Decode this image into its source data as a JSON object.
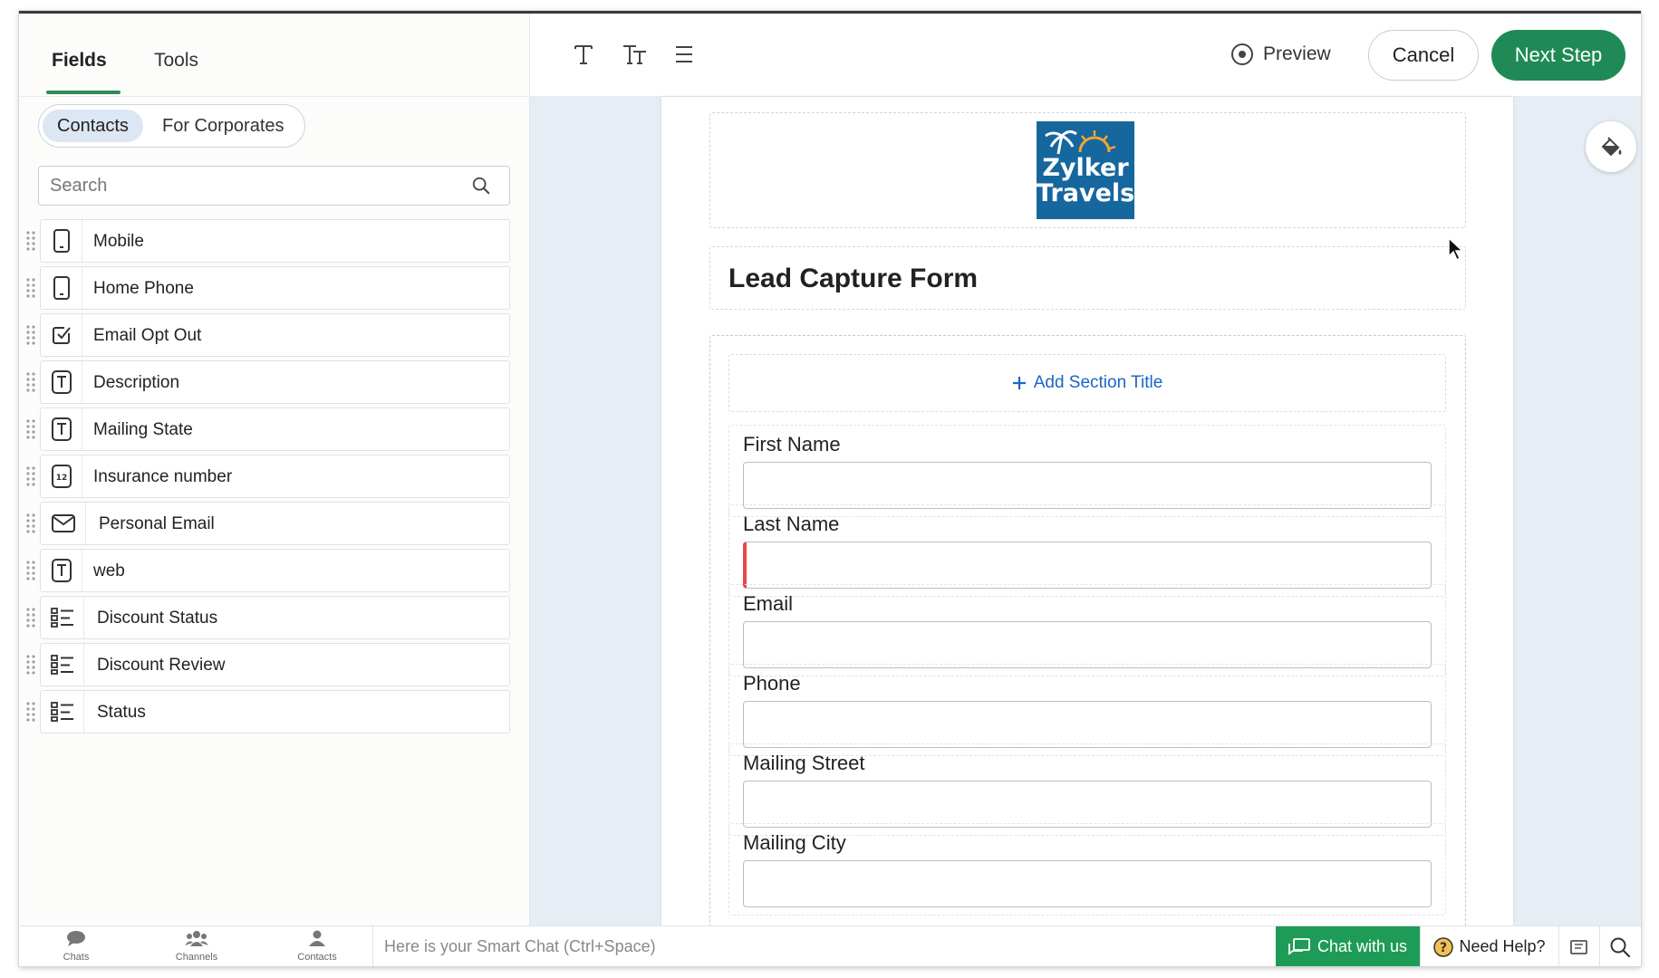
{
  "left_panel": {
    "tabs": [
      {
        "label": "Fields"
      },
      {
        "label": "Tools"
      }
    ],
    "segments": [
      {
        "label": "Contacts"
      },
      {
        "label": "For Corporates"
      }
    ],
    "search": {
      "placeholder": "Search"
    },
    "fields": [
      {
        "label": "Mobile",
        "icon": "phone-icon"
      },
      {
        "label": "Home Phone",
        "icon": "phone-icon"
      },
      {
        "label": "Email Opt Out",
        "icon": "checkbox-icon"
      },
      {
        "label": "Description",
        "icon": "text-field-icon"
      },
      {
        "label": "Mailing State",
        "icon": "text-field-icon"
      },
      {
        "label": "Insurance number",
        "icon": "number-field-icon"
      },
      {
        "label": "Personal Email",
        "icon": "envelope-icon"
      },
      {
        "label": "web",
        "icon": "text-field-icon"
      },
      {
        "label": "Discount Status",
        "icon": "picklist-icon"
      },
      {
        "label": "Discount Review",
        "icon": "picklist-icon"
      },
      {
        "label": "Status",
        "icon": "picklist-icon"
      }
    ]
  },
  "toolbar": {
    "preview_label": "Preview",
    "cancel_label": "Cancel",
    "next_label": "Next Step"
  },
  "form": {
    "logo": {
      "line1": "Zylker",
      "line2": "Travels"
    },
    "title": "Lead Capture Form",
    "add_section_label": "Add Section Title",
    "fields": [
      {
        "label": "First Name",
        "required": false
      },
      {
        "label": "Last Name",
        "required": true
      },
      {
        "label": "Email",
        "required": false
      },
      {
        "label": "Phone",
        "required": false
      },
      {
        "label": "Mailing Street",
        "required": false
      },
      {
        "label": "Mailing City",
        "required": false
      }
    ]
  },
  "bottom_bar": {
    "nav": [
      {
        "label": "Chats"
      },
      {
        "label": "Channels"
      },
      {
        "label": "Contacts"
      }
    ],
    "smart_chat_placeholder": "Here is your Smart Chat (Ctrl+Space)",
    "chat_label": "Chat with us",
    "help_label": "Need Help?"
  },
  "colors": {
    "accent_green": "#1f8a55",
    "link_blue": "#1a66c6",
    "required_red": "#e5474a",
    "logo_blue": "#15679e"
  }
}
